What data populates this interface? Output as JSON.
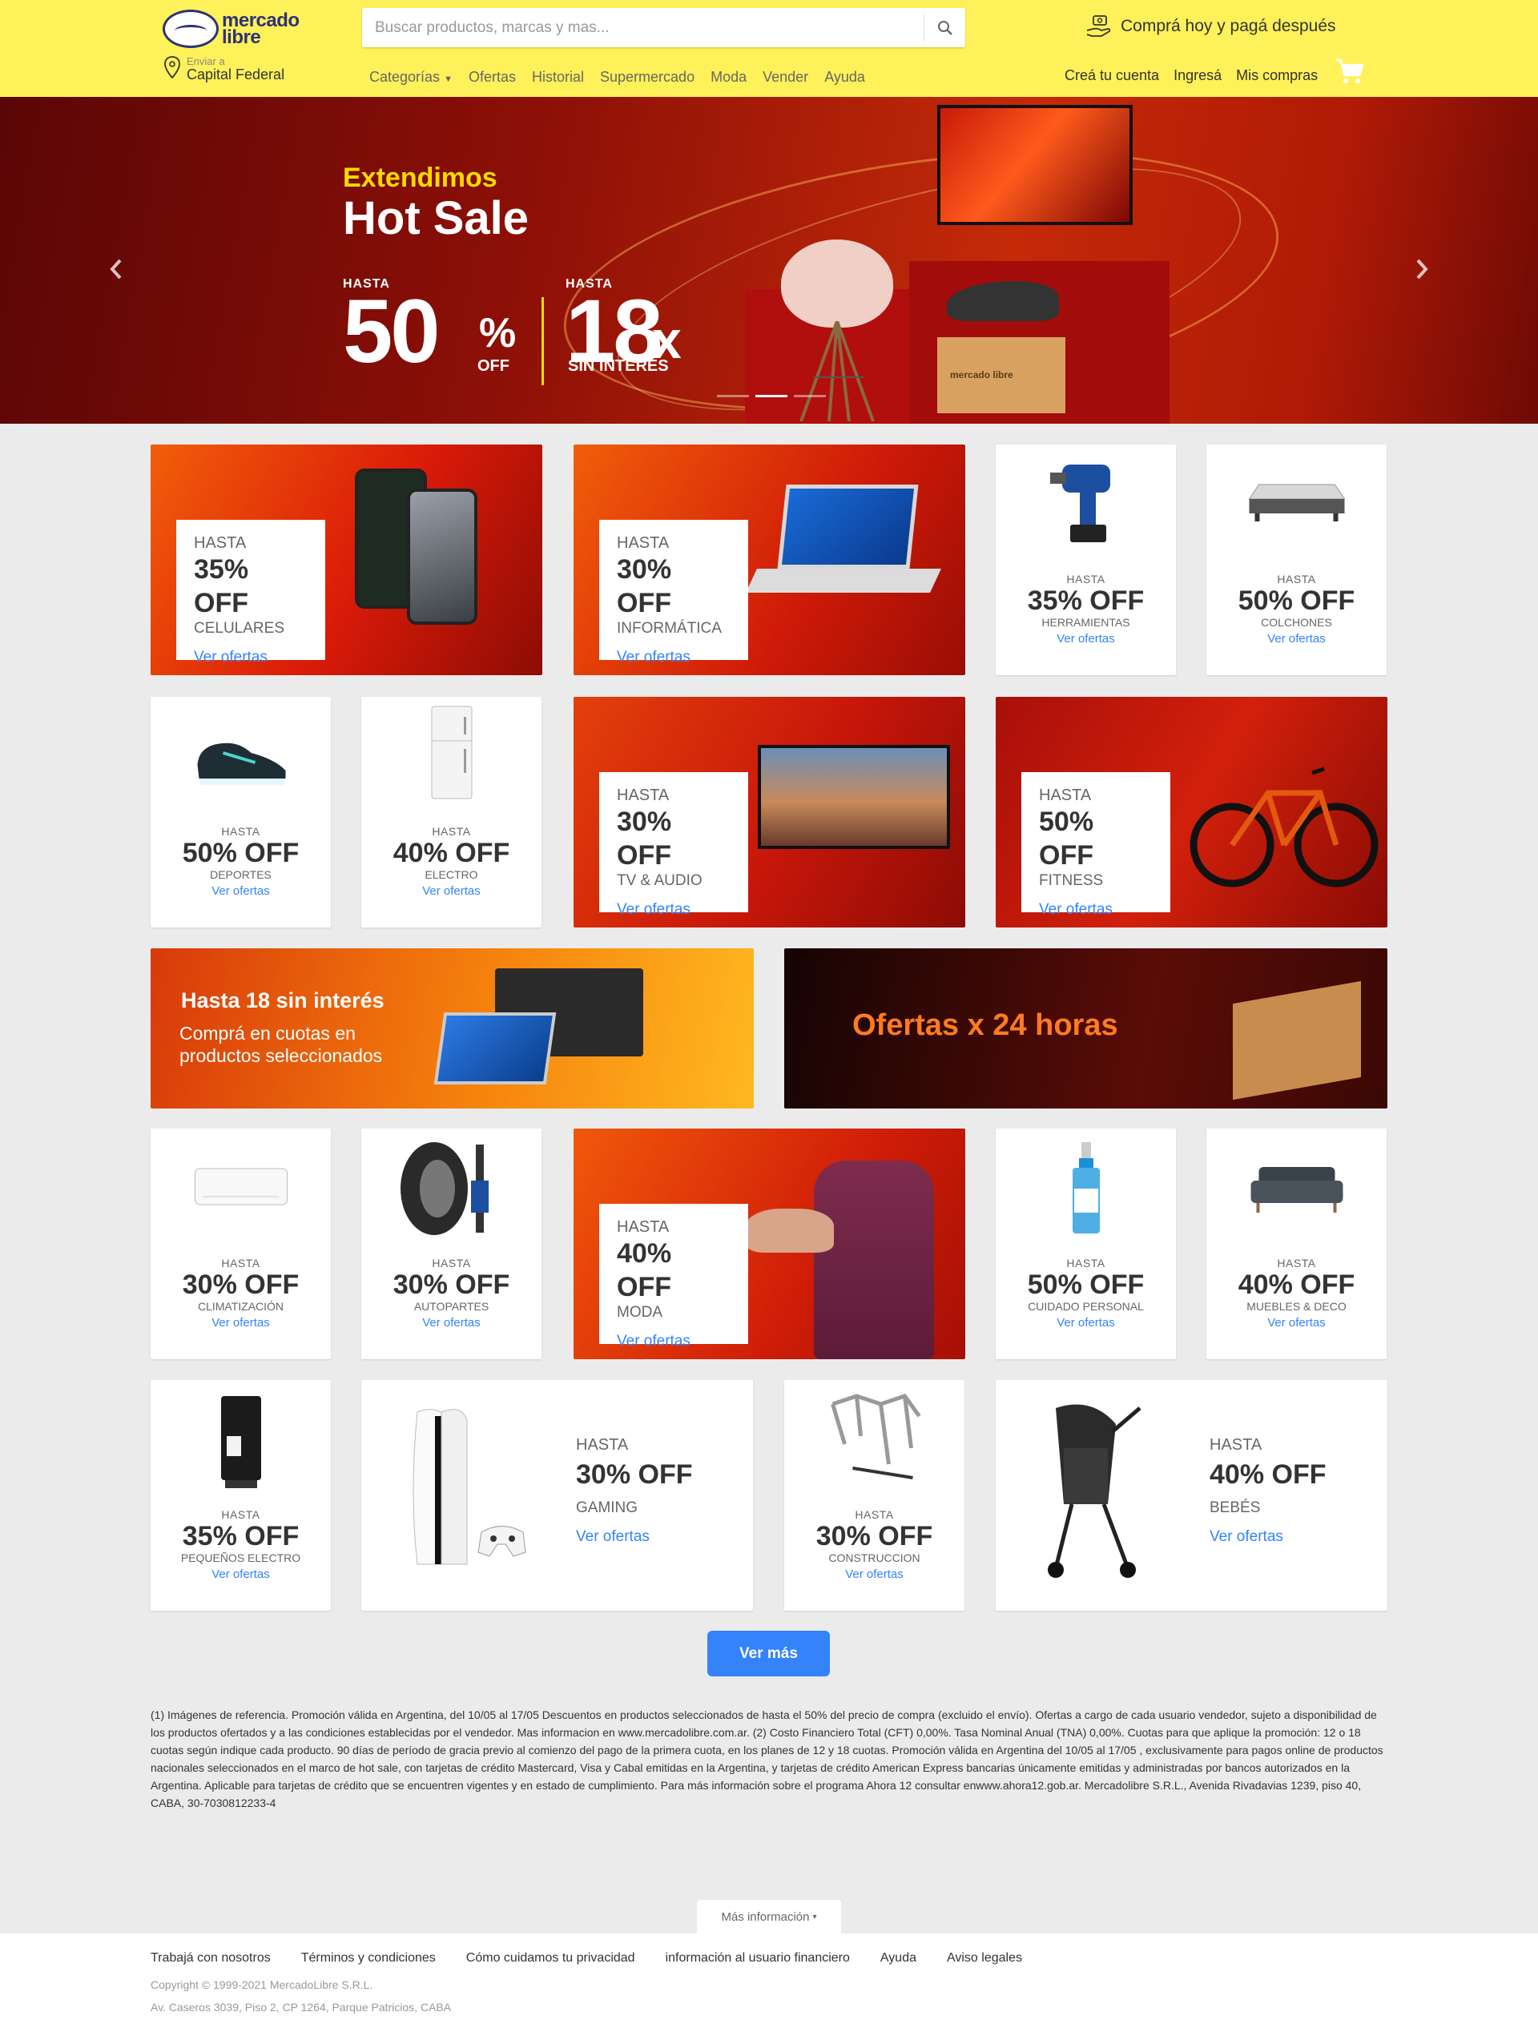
{
  "header": {
    "logo_text_1": "mercado",
    "logo_text_2": "libre",
    "search_placeholder": "Buscar productos, marcas y mas...",
    "promo": "Comprá hoy y pagá después",
    "ship_label": "Enviar a",
    "ship_location": "Capital Federal",
    "nav": [
      "Categorías",
      "Ofertas",
      "Historial",
      "Supermercado",
      "Moda",
      "Vender",
      "Ayuda"
    ],
    "account": [
      "Creá tu cuenta",
      "Ingresá",
      "Mis compras"
    ]
  },
  "hero": {
    "subtitle": "Extendimos",
    "title": "Hot Sale",
    "left_hasta": "HASTA",
    "left_num": "50",
    "left_unit": "%",
    "left_off": "OFF",
    "right_hasta": "HASTA",
    "right_num": "18",
    "right_unit": "x",
    "right_sub": "SIN INTERÉS",
    "box_logo": "mercado libre"
  },
  "cards": {
    "celulares": {
      "hasta": "HASTA",
      "off": "35% OFF",
      "cat": "CELULARES",
      "link": "Ver ofertas"
    },
    "informatica": {
      "hasta": "HASTA",
      "off": "30% OFF",
      "cat": "INFORMÁTICA",
      "link": "Ver ofertas"
    },
    "herramientas": {
      "hasta": "HASTA",
      "off": "35% OFF",
      "cat": "HERRAMIENTAS",
      "link": "Ver ofertas"
    },
    "colchones": {
      "hasta": "HASTA",
      "off": "50% OFF",
      "cat": "COLCHONES",
      "link": "Ver ofertas"
    },
    "deportes": {
      "hasta": "HASTA",
      "off": "50% OFF",
      "cat": "DEPORTES",
      "link": "Ver ofertas"
    },
    "electro": {
      "hasta": "HASTA",
      "off": "40% OFF",
      "cat": "ELECTRO",
      "link": "Ver ofertas"
    },
    "tv": {
      "hasta": "HASTA",
      "off": "30% OFF",
      "cat": "TV & AUDIO",
      "link": "Ver ofertas"
    },
    "fitness": {
      "hasta": "HASTA",
      "off": "50% OFF",
      "cat": "FITNESS",
      "link": "Ver ofertas"
    },
    "climatizacion": {
      "hasta": "HASTA",
      "off": "30% OFF",
      "cat": "CLIMATIZACIÓN",
      "link": "Ver ofertas"
    },
    "autopartes": {
      "hasta": "HASTA",
      "off": "30% OFF",
      "cat": "AUTOPARTES",
      "link": "Ver ofertas"
    },
    "moda": {
      "hasta": "HASTA",
      "off": "40% OFF",
      "cat": "MODA",
      "link": "Ver ofertas"
    },
    "cuidado": {
      "hasta": "HASTA",
      "off": "50% OFF",
      "cat": "CUIDADO PERSONAL",
      "link": "Ver ofertas"
    },
    "muebles": {
      "hasta": "HASTA",
      "off": "40% OFF",
      "cat": "MUEBLES & DECO",
      "link": "Ver ofertas"
    },
    "pequenos": {
      "hasta": "HASTA",
      "off": "35% OFF",
      "cat": "PEQUEÑOS ELECTRO",
      "link": "Ver ofertas"
    },
    "gaming": {
      "hasta": "HASTA",
      "off": "30% OFF",
      "cat": "GAMING",
      "link": "Ver ofertas"
    },
    "construccion": {
      "hasta": "HASTA",
      "off": "30% OFF",
      "cat": "CONSTRUCCION",
      "link": "Ver ofertas"
    },
    "bebes": {
      "hasta": "HASTA",
      "off": "40% OFF",
      "cat": "BEBÉS",
      "link": "Ver ofertas"
    }
  },
  "banners": {
    "cuotas_title": "Hasta 18 sin interés",
    "cuotas_sub_1": "Comprá en cuotas en",
    "cuotas_sub_2": "productos seleccionados",
    "ofertas24": "Ofertas x 24 horas"
  },
  "ver_mas": "Ver más",
  "legal": "(1) Imágenes de referencia. Promoción válida en Argentina, del 10/05 al 17/05 Descuentos en productos seleccionados de hasta el 50% del precio de compra (excluido el envío). Ofertas a cargo de cada usuario vendedor, sujeto a disponibilidad de los productos ofertados y a las condiciones establecidas por el vendedor. Mas informacion en www.mercadolibre.com.ar. (2) Costo Financiero Total (CFT) 0,00%. Tasa Nominal Anual (TNA) 0,00%. Cuotas para que aplique la promoción: 12 o 18 cuotas según indique cada producto. 90 días de período de gracia previo al comienzo del pago de la primera cuota, en los planes de 12 y 18 cuotas. Promoción válida en Argentina del 10/05 al 17/05 , exclusivamente para pagos online de productos nacionales seleccionados en el marco de hot sale, con tarjetas de crédito Mastercard, Visa y Cabal emitidas en la Argentina, y tarjetas de crédito American Express bancarias únicamente emitidas y administradas por bancos autorizados en la Argentina. Aplicable para tarjetas de crédito que se encuentren vigentes y en estado de cumplimiento. Para más información sobre el programa Ahora 12 consultar enwww.ahora12.gob.ar. Mercadolibre S.R.L., Avenida Rivadavias 1239, piso 40, CABA, 30-7030812233-4",
  "footer": {
    "mas_info": "Más información",
    "links": [
      "Trabajá con nosotros",
      "Términos y condiciones",
      "Cómo cuidamos tu privacidad",
      "información al usuario financiero",
      "Ayuda",
      "Aviso legales"
    ],
    "copyright": "Copyright © 1999-2021 MercadoLibre S.R.L.",
    "address": "Av. Caseros 3039, Piso 2, CP 1264, Parque Patricios, CABA"
  }
}
